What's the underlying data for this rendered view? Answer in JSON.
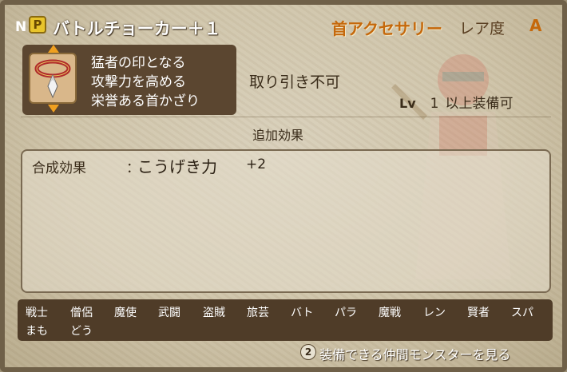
{
  "header": {
    "n_marker": "N",
    "category_icon_glyph": "P",
    "item_name": "バトルチョーカー＋１",
    "item_type": "首アクセサリー",
    "rarity_label": "レア度",
    "rarity_value": "A"
  },
  "description": {
    "lines": [
      "猛者の印となる",
      "攻撃力を高める",
      "栄誉ある首かざり"
    ]
  },
  "trade_status": "取り引き不可",
  "level_requirement": {
    "lv_label": "Lv",
    "level": "1",
    "suffix": "以上装備可"
  },
  "effects": {
    "section_title": "追加効果",
    "rows": [
      {
        "label": "合成効果",
        "separator": "：",
        "value": "こうげき力",
        "amount": "+2"
      }
    ]
  },
  "jobs": {
    "row1": [
      "戦士",
      "僧侶",
      "魔使",
      "武闘",
      "盗賊",
      "旅芸",
      "バト",
      "パラ",
      "魔戦",
      "レン",
      "賢者",
      "スパ"
    ],
    "row2": [
      "まも",
      "どう"
    ]
  },
  "footer": {
    "button_glyph": "2",
    "text": "装備できる仲間モンスターを見る"
  },
  "colors": {
    "accent": "#c5680b",
    "panel_dark": "#5b4630",
    "gold_icon": "#e8c42c"
  },
  "icons": [
    "gold-category-icon",
    "choker-item-icon",
    "arrow-up-icon",
    "arrow-down-icon",
    "button-2-icon"
  ]
}
